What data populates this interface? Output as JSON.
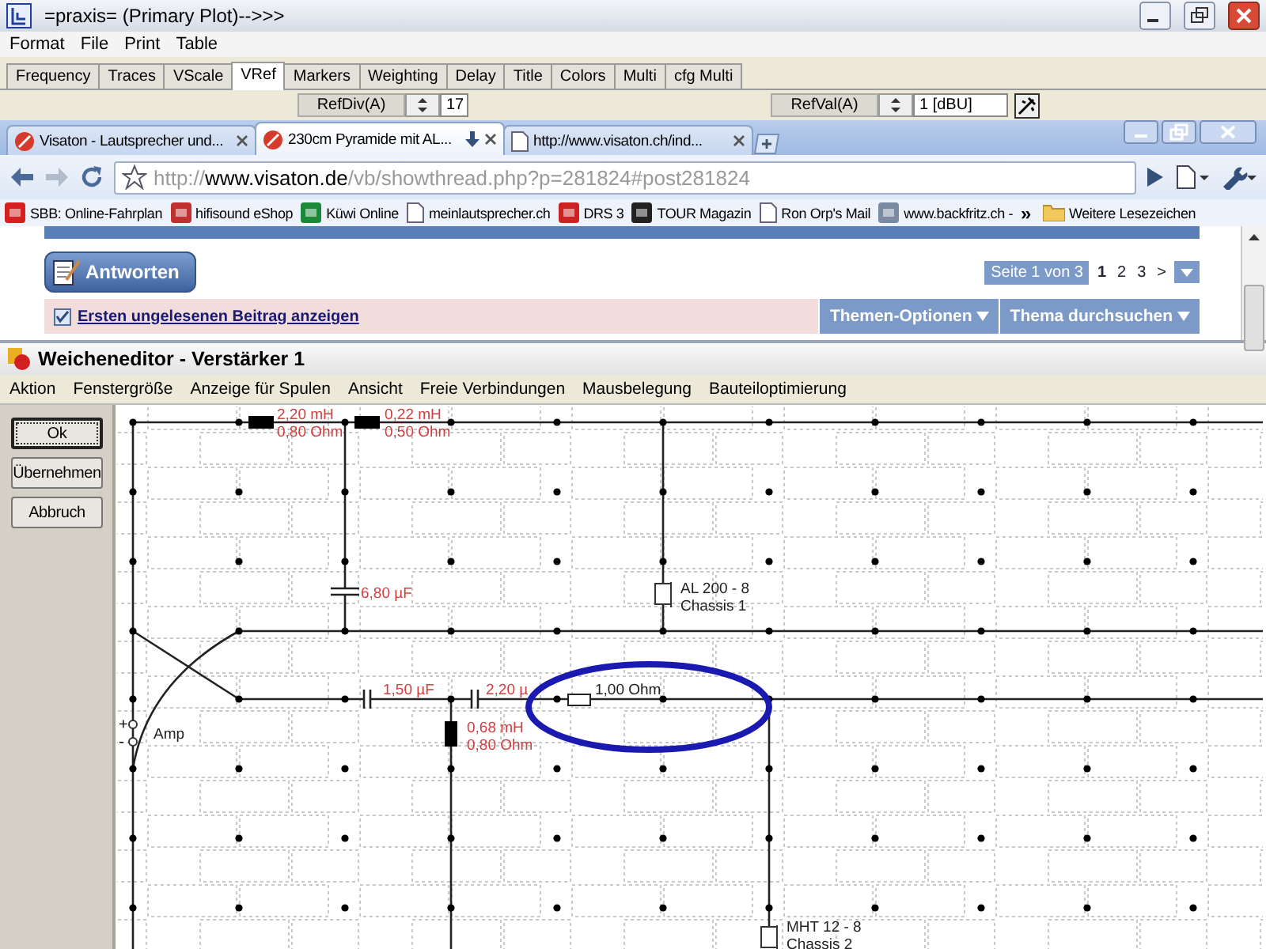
{
  "app_window": {
    "title": "=praxis= (Primary Plot)-->>>",
    "menu": [
      "Format",
      "File",
      "Print",
      "Table"
    ],
    "tabs": [
      {
        "label": "Frequency",
        "selected": false
      },
      {
        "label": "Traces",
        "selected": false
      },
      {
        "label": "VScale",
        "selected": false
      },
      {
        "label": "VRef",
        "selected": true
      },
      {
        "label": "Markers",
        "selected": false
      },
      {
        "label": "Weighting",
        "selected": false
      },
      {
        "label": "Delay",
        "selected": false
      },
      {
        "label": "Title",
        "selected": false
      },
      {
        "label": "Colors",
        "selected": false
      },
      {
        "label": "Multi",
        "selected": false
      },
      {
        "label": "cfg Multi",
        "selected": false
      }
    ],
    "fields": [
      {
        "label": "RefDiv(A)",
        "value": "17"
      },
      {
        "label": "RefVal(A)",
        "value": "1 [dBU]"
      }
    ]
  },
  "browser": {
    "tabs": [
      {
        "title": "Visaton - Lautsprecher und...",
        "kind": "logo",
        "selected": false
      },
      {
        "title": "230cm Pyramide mit AL...",
        "kind": "logo",
        "selected": true
      },
      {
        "title": "http://www.visaton.ch/ind...",
        "kind": "page",
        "selected": false
      }
    ],
    "url": {
      "scheme": "http://",
      "host": "www.visaton.de",
      "path": "/vb/showthread.php?p=281824#post281824"
    },
    "bookmarks": [
      {
        "label": "SBB: Online-Fahrplan",
        "kind": "logo",
        "color": "#d42020"
      },
      {
        "label": "hifisound eShop",
        "kind": "logo",
        "color": "#c03030"
      },
      {
        "label": "Küwi Online",
        "kind": "logo",
        "color": "#1a8a3a"
      },
      {
        "label": "meinlautsprecher.ch",
        "kind": "page"
      },
      {
        "label": "DRS 3",
        "kind": "logo",
        "color": "#cc2222"
      },
      {
        "label": "TOUR Magazin",
        "kind": "logo",
        "color": "#222222"
      },
      {
        "label": "Ron Orp's Mail",
        "kind": "page"
      },
      {
        "label": "www.backfritz.ch -",
        "kind": "logo",
        "color": "#7a8aa0"
      }
    ],
    "overflow": "»",
    "other_bookmarks": "Weitere Lesezeichen"
  },
  "forum": {
    "reply_button": "Antworten",
    "page_summary": "Seite 1 von 3",
    "pages": [
      {
        "label": "1",
        "selected": true
      },
      {
        "label": "2",
        "selected": false
      },
      {
        "label": "3",
        "selected": false
      }
    ],
    "next": ">",
    "unread_link": "Ersten ungelesenen Beitrag anzeigen",
    "menus": [
      "Themen-Optionen",
      "Thema durchsuchen"
    ]
  },
  "editor": {
    "title": "Weicheneditor - Verstärker 1",
    "menu": [
      "Aktion",
      "Fenstergröße",
      "Anzeige für Spulen",
      "Ansicht",
      "Freie Verbindungen",
      "Mausbelegung",
      "Bauteiloptimierung"
    ],
    "buttons": [
      {
        "label": "Ok",
        "default": true
      },
      {
        "label": "Übernehmen",
        "default": false
      },
      {
        "label": "Abbruch",
        "default": false
      }
    ],
    "components": [
      {
        "kind": "inductor",
        "labels": [
          "2,20 mH",
          "0,80 Ohm"
        ]
      },
      {
        "kind": "inductor",
        "labels": [
          "0,22 mH",
          "0,50 Ohm"
        ]
      },
      {
        "kind": "capacitor",
        "labels": [
          "6,80 µF"
        ]
      },
      {
        "kind": "speaker",
        "labels": [
          "AL 200 - 8",
          "Chassis 1"
        ]
      },
      {
        "kind": "capacitor",
        "labels": [
          "1,50 µF"
        ]
      },
      {
        "kind": "capacitor",
        "labels": [
          "2,20 µ"
        ]
      },
      {
        "kind": "inductor",
        "labels": [
          "0,68 mH",
          "0,80 Ohm"
        ]
      },
      {
        "kind": "resistor",
        "labels": [
          "1,00 Ohm"
        ]
      },
      {
        "kind": "speaker",
        "labels": [
          "MHT 12 - 8",
          "Chassis 2"
        ]
      },
      {
        "kind": "amp",
        "labels": [
          "Amp"
        ],
        "terminals": [
          "+",
          "-"
        ]
      }
    ]
  }
}
